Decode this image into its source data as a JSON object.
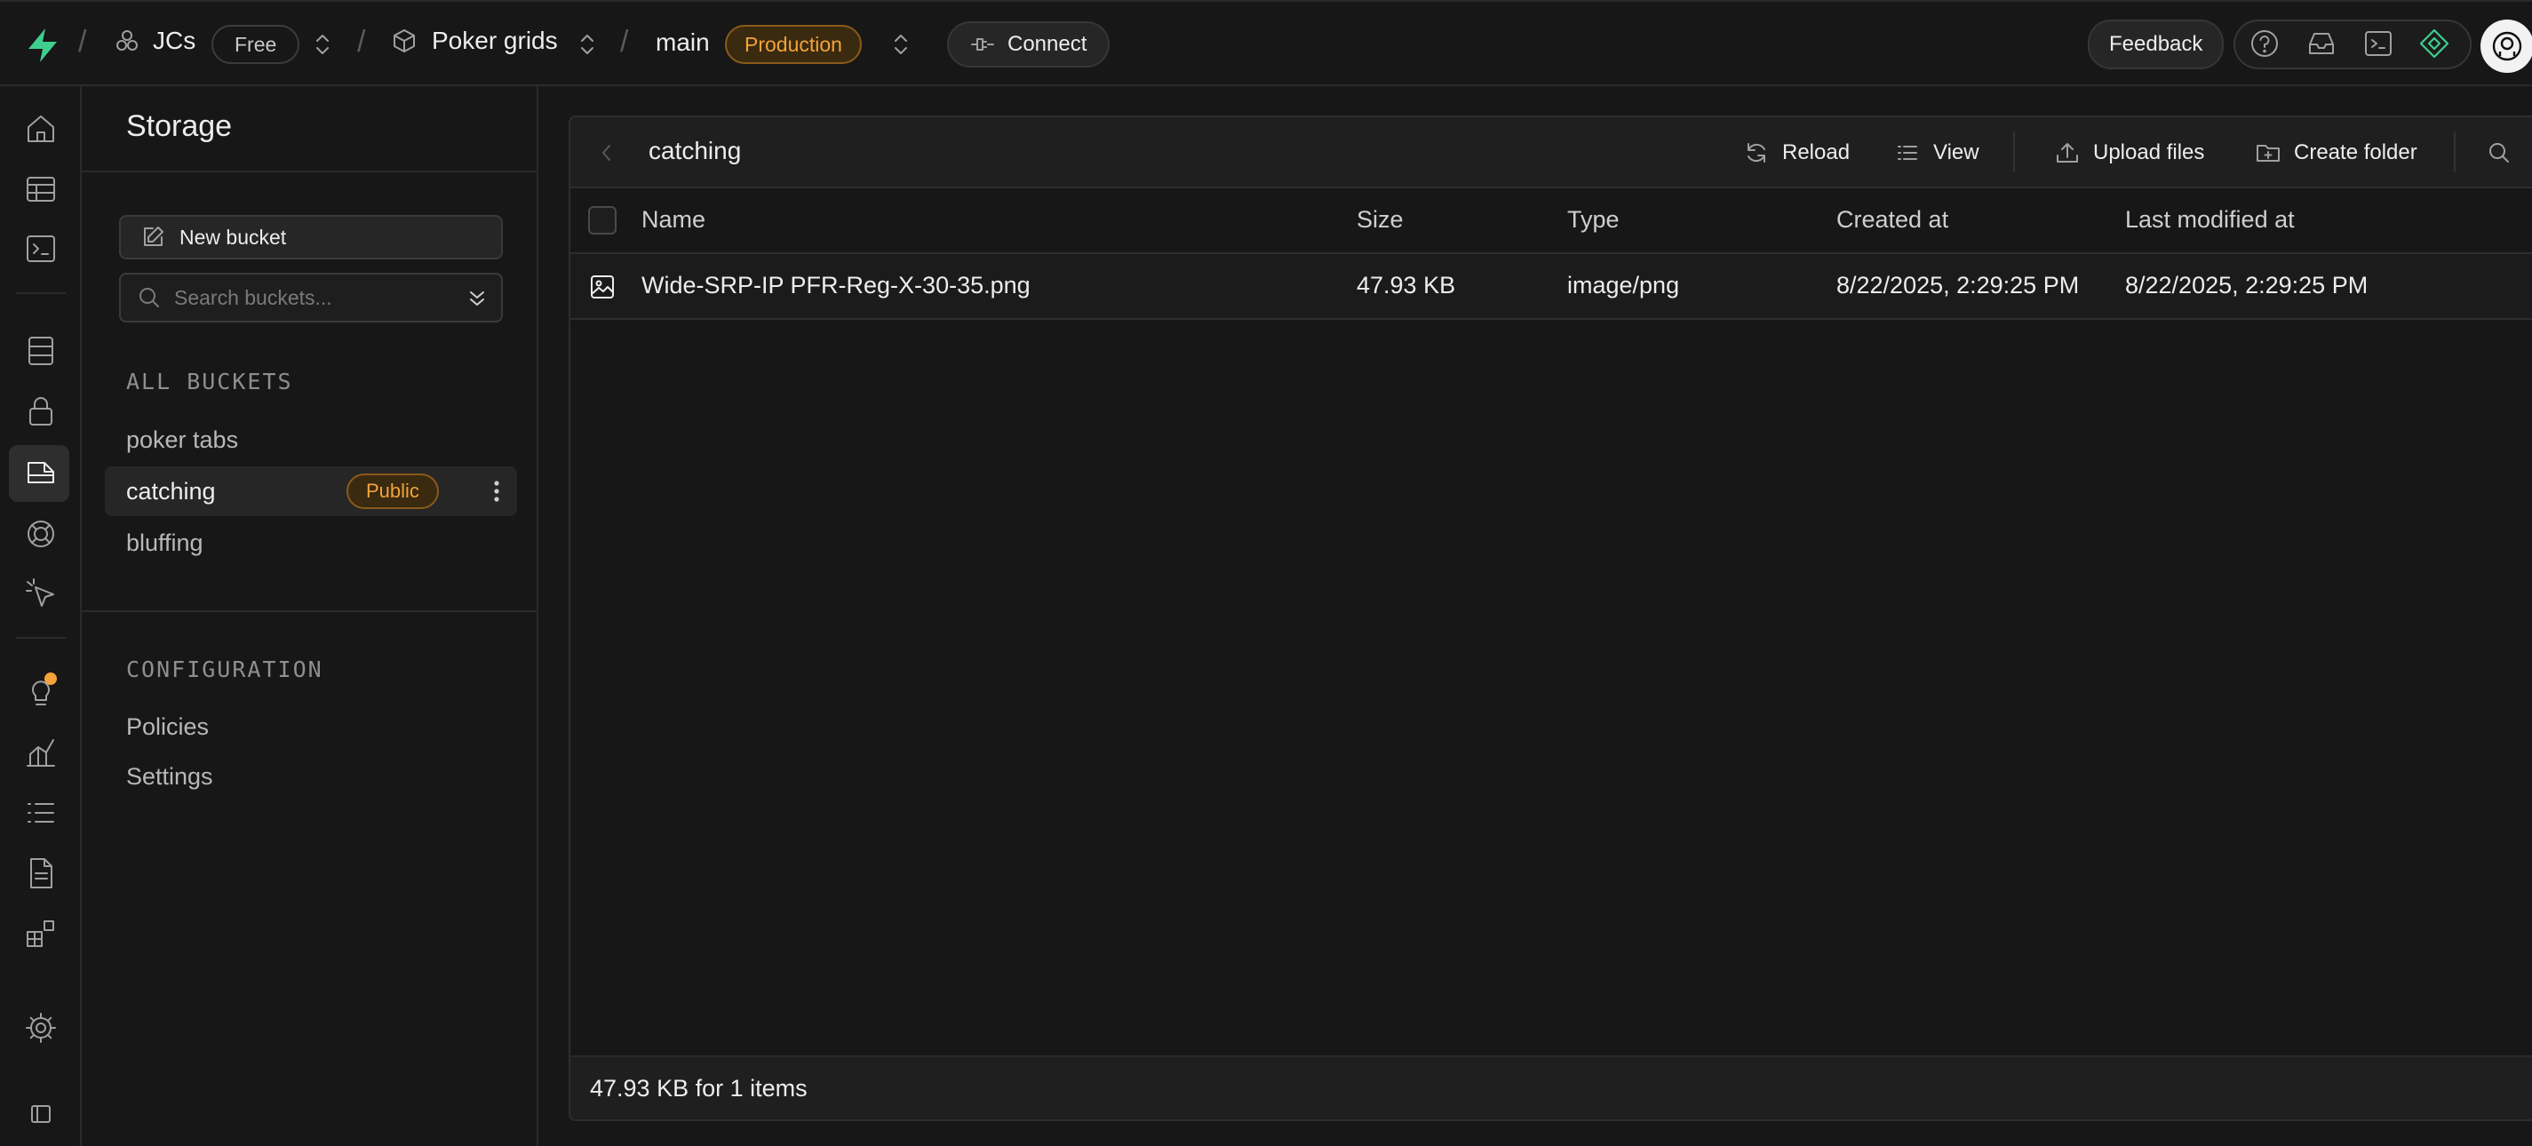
{
  "topbar": {
    "org": "JCs",
    "plan": "Free",
    "project": "Poker grids",
    "branch": "main",
    "env": "Production",
    "connect": "Connect",
    "feedback": "Feedback"
  },
  "sidebar": {
    "title": "Storage",
    "new_bucket": "New bucket",
    "search_placeholder": "Search buckets...",
    "all_buckets_label": "ALL BUCKETS",
    "buckets": [
      {
        "name": "poker tabs"
      },
      {
        "name": "catching",
        "badge": "Public",
        "active": true
      },
      {
        "name": "bluffing"
      }
    ],
    "config_label": "CONFIGURATION",
    "config_items": [
      "Policies",
      "Settings"
    ]
  },
  "explorer": {
    "current_bucket": "catching",
    "toolbar": {
      "reload": "Reload",
      "view": "View",
      "upload": "Upload files",
      "create_folder": "Create folder"
    },
    "columns": [
      "Name",
      "Size",
      "Type",
      "Created at",
      "Last modified at"
    ],
    "rows": [
      {
        "name": "Wide-SRP-IP PFR-Reg-X-30-35.png",
        "size": "47.93 KB",
        "type": "image/png",
        "created": "8/22/2025, 2:29:25 PM",
        "modified": "8/22/2025, 2:29:25 PM"
      }
    ],
    "footer": "47.93 KB for 1 items"
  },
  "colors": {
    "accent_green": "#3ecf8e",
    "warning_orange": "#f3a33a",
    "background": "#171717"
  }
}
